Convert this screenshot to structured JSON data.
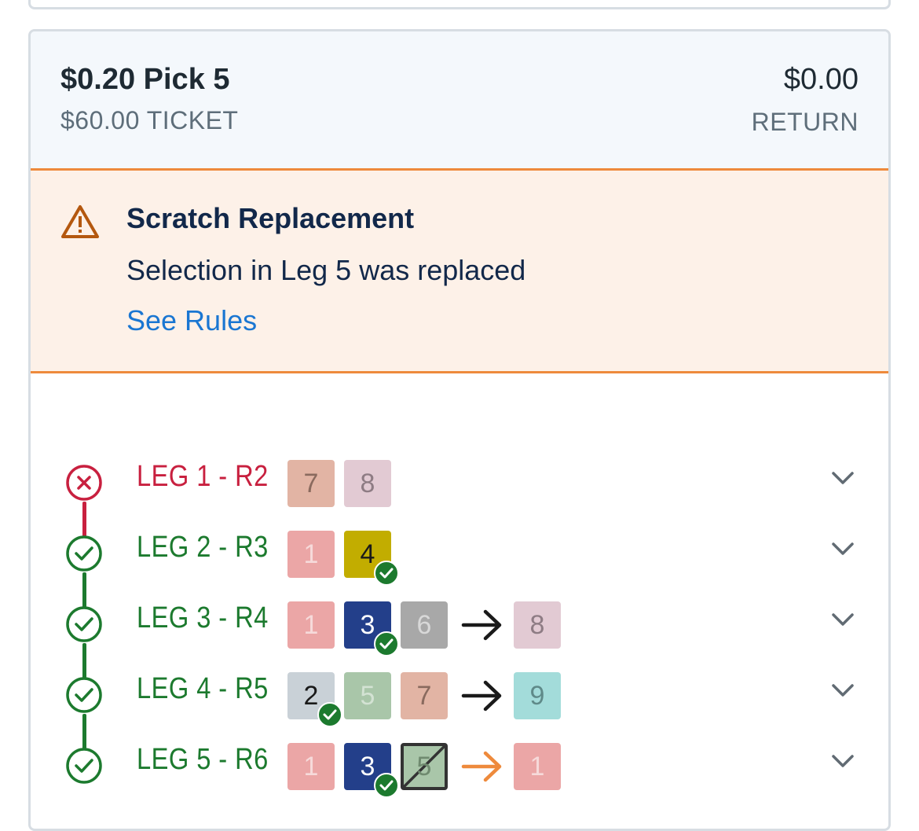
{
  "wager": {
    "title": "$0.20 Pick 5",
    "ticket": "$60.00 TICKET",
    "return_amount": "$0.00",
    "return_label": "RETURN"
  },
  "alert": {
    "icon": "warning-triangle-icon",
    "title": "Scratch Replacement",
    "message": "Selection in Leg 5 was replaced",
    "link": "See Rules",
    "colors": {
      "background": "#fdf1e8",
      "border": "#ee8a3c",
      "link": "#1a76d2"
    }
  },
  "colors": {
    "lost": "#c8203f",
    "won": "#1c7a2e",
    "replacement_arrow": "#ee8a3c"
  },
  "legs": [
    {
      "label": "LEG 1 - R2",
      "status": "lost",
      "runners": [
        {
          "num": "7",
          "bg": "#e2b4a4",
          "fg": "#8a6a5e",
          "winner": false
        },
        {
          "num": "8",
          "bg": "#e2cad3",
          "fg": "#8e7c84",
          "winner": false
        }
      ]
    },
    {
      "label": "LEG 2 - R3",
      "status": "won",
      "runners": [
        {
          "num": "1",
          "bg": "#eba6a6",
          "fg": "#f6dada",
          "winner": false
        },
        {
          "num": "4",
          "bg": "#c2ad00",
          "fg": "#1a1a1a",
          "winner": true
        }
      ]
    },
    {
      "label": "LEG 3 - R4",
      "status": "won",
      "runners": [
        {
          "num": "1",
          "bg": "#eba6a6",
          "fg": "#f6dada",
          "winner": false
        },
        {
          "num": "3",
          "bg": "#233f8a",
          "fg": "#ffffff",
          "winner": true
        },
        {
          "num": "6",
          "bg": "#a8a8a8",
          "fg": "#d8d8d8",
          "winner": false
        }
      ],
      "arrow": "black",
      "replacement": {
        "num": "8",
        "bg": "#e2cad3",
        "fg": "#8e7c84"
      }
    },
    {
      "label": "LEG 4 - R5",
      "status": "won",
      "runners": [
        {
          "num": "2",
          "bg": "#c9d1d7",
          "fg": "#1a1a1a",
          "winner": true
        },
        {
          "num": "5",
          "bg": "#a9c6a9",
          "fg": "#d3e2d3",
          "winner": false
        },
        {
          "num": "7",
          "bg": "#e2b4a4",
          "fg": "#8a6a5e",
          "winner": false
        }
      ],
      "arrow": "black",
      "replacement": {
        "num": "9",
        "bg": "#a3dcda",
        "fg": "#5f8a89"
      }
    },
    {
      "label": "LEG 5 - R6",
      "status": "won",
      "runners": [
        {
          "num": "1",
          "bg": "#eba6a6",
          "fg": "#f6dada",
          "winner": false
        },
        {
          "num": "3",
          "bg": "#233f8a",
          "fg": "#ffffff",
          "winner": true
        },
        {
          "num": "5",
          "bg": "#a9c6a9",
          "fg": "#6f8a6f",
          "winner": false,
          "scratched": true
        }
      ],
      "arrow": "orange",
      "replacement": {
        "num": "1",
        "bg": "#eba6a6",
        "fg": "#f6dada"
      }
    }
  ]
}
